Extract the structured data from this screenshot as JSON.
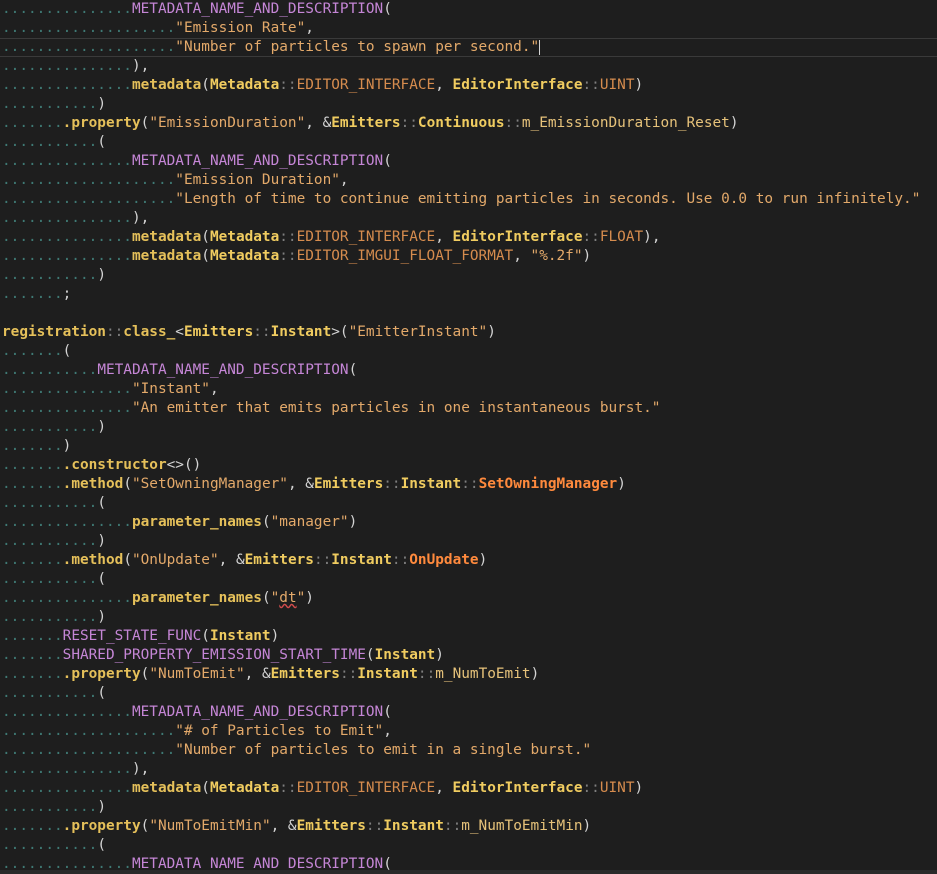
{
  "editor": {
    "lines": [
      [
        {
          "t": "...............",
          "c": "ws"
        },
        {
          "t": "METADATA_NAME_AND_DESCRIPTION",
          "c": "t-macro"
        },
        {
          "t": "(",
          "c": "t-punc"
        }
      ],
      [
        {
          "t": "....................",
          "c": "ws"
        },
        {
          "t": "\"Emission Rate\"",
          "c": "t-str"
        },
        {
          "t": ",",
          "c": "t-punc"
        }
      ],
      [
        {
          "t": "....................",
          "c": "ws"
        },
        {
          "t": "\"Number of particles to spawn per second.\"",
          "c": "t-str"
        },
        {
          "t": "|",
          "c": "cursor"
        }
      ],
      [
        {
          "t": "...............",
          "c": "ws"
        },
        {
          "t": "),",
          "c": "t-punc"
        }
      ],
      [
        {
          "t": "...............",
          "c": "ws"
        },
        {
          "t": "metadata",
          "c": "t-fn"
        },
        {
          "t": "(",
          "c": "t-punc"
        },
        {
          "t": "Metadata",
          "c": "t-type"
        },
        {
          "t": "::",
          "c": "t-op"
        },
        {
          "t": "EDITOR_INTERFACE",
          "c": "t-enum"
        },
        {
          "t": ", ",
          "c": "t-punc"
        },
        {
          "t": "EditorInterface",
          "c": "t-type"
        },
        {
          "t": "::",
          "c": "t-op"
        },
        {
          "t": "UINT",
          "c": "t-enum"
        },
        {
          "t": ")",
          "c": "t-punc"
        }
      ],
      [
        {
          "t": "...........",
          "c": "ws"
        },
        {
          "t": ")",
          "c": "t-punc"
        }
      ],
      [
        {
          "t": ".......",
          "c": "ws"
        },
        {
          "t": ".property",
          "c": "t-fn"
        },
        {
          "t": "(",
          "c": "t-punc"
        },
        {
          "t": "\"EmissionDuration\"",
          "c": "t-str"
        },
        {
          "t": ", &",
          "c": "t-punc"
        },
        {
          "t": "Emitters",
          "c": "t-type"
        },
        {
          "t": "::",
          "c": "t-op"
        },
        {
          "t": "Continuous",
          "c": "t-type"
        },
        {
          "t": "::",
          "c": "t-op"
        },
        {
          "t": "m_EmissionDuration_Reset",
          "c": "t-member"
        },
        {
          "t": ")",
          "c": "t-punc"
        }
      ],
      [
        {
          "t": "...........",
          "c": "ws"
        },
        {
          "t": "(",
          "c": "t-punc"
        }
      ],
      [
        {
          "t": "...............",
          "c": "ws"
        },
        {
          "t": "METADATA_NAME_AND_DESCRIPTION",
          "c": "t-macro"
        },
        {
          "t": "(",
          "c": "t-punc"
        }
      ],
      [
        {
          "t": "....................",
          "c": "ws"
        },
        {
          "t": "\"Emission Duration\"",
          "c": "t-str"
        },
        {
          "t": ",",
          "c": "t-punc"
        }
      ],
      [
        {
          "t": "....................",
          "c": "ws"
        },
        {
          "t": "\"Length of time to continue emitting particles in seconds. Use 0.0 to run infinitely.\"",
          "c": "t-str"
        }
      ],
      [
        {
          "t": "...............",
          "c": "ws"
        },
        {
          "t": "),",
          "c": "t-punc"
        }
      ],
      [
        {
          "t": "...............",
          "c": "ws"
        },
        {
          "t": "metadata",
          "c": "t-fn"
        },
        {
          "t": "(",
          "c": "t-punc"
        },
        {
          "t": "Metadata",
          "c": "t-type"
        },
        {
          "t": "::",
          "c": "t-op"
        },
        {
          "t": "EDITOR_INTERFACE",
          "c": "t-enum"
        },
        {
          "t": ", ",
          "c": "t-punc"
        },
        {
          "t": "EditorInterface",
          "c": "t-type"
        },
        {
          "t": "::",
          "c": "t-op"
        },
        {
          "t": "FLOAT",
          "c": "t-enum"
        },
        {
          "t": "),",
          "c": "t-punc"
        }
      ],
      [
        {
          "t": "...............",
          "c": "ws"
        },
        {
          "t": "metadata",
          "c": "t-fn"
        },
        {
          "t": "(",
          "c": "t-punc"
        },
        {
          "t": "Metadata",
          "c": "t-type"
        },
        {
          "t": "::",
          "c": "t-op"
        },
        {
          "t": "EDITOR_IMGUI_FLOAT_FORMAT",
          "c": "t-enum"
        },
        {
          "t": ", ",
          "c": "t-punc"
        },
        {
          "t": "\"%.2f\"",
          "c": "t-str"
        },
        {
          "t": ")",
          "c": "t-punc"
        }
      ],
      [
        {
          "t": "...........",
          "c": "ws"
        },
        {
          "t": ")",
          "c": "t-punc"
        }
      ],
      [
        {
          "t": ".......",
          "c": "ws"
        },
        {
          "t": ";",
          "c": "t-punc"
        }
      ],
      [
        {
          "t": "",
          "c": "t-plain"
        }
      ],
      [
        {
          "t": "registration",
          "c": "t-fn"
        },
        {
          "t": "::",
          "c": "t-op"
        },
        {
          "t": "class_",
          "c": "t-fn"
        },
        {
          "t": "<",
          "c": "t-punc"
        },
        {
          "t": "Emitters",
          "c": "t-type"
        },
        {
          "t": "::",
          "c": "t-op"
        },
        {
          "t": "Instant",
          "c": "t-type"
        },
        {
          "t": ">(",
          "c": "t-punc"
        },
        {
          "t": "\"EmitterInstant\"",
          "c": "t-str"
        },
        {
          "t": ")",
          "c": "t-punc"
        }
      ],
      [
        {
          "t": ".......",
          "c": "ws"
        },
        {
          "t": "(",
          "c": "t-punc"
        }
      ],
      [
        {
          "t": "...........",
          "c": "ws"
        },
        {
          "t": "METADATA_NAME_AND_DESCRIPTION",
          "c": "t-macro"
        },
        {
          "t": "(",
          "c": "t-punc"
        }
      ],
      [
        {
          "t": "...............",
          "c": "ws"
        },
        {
          "t": "\"Instant\"",
          "c": "t-str"
        },
        {
          "t": ",",
          "c": "t-punc"
        }
      ],
      [
        {
          "t": "...............",
          "c": "ws"
        },
        {
          "t": "\"An emitter that emits particles in one instantaneous burst.\"",
          "c": "t-str"
        }
      ],
      [
        {
          "t": "...........",
          "c": "ws"
        },
        {
          "t": ")",
          "c": "t-punc"
        }
      ],
      [
        {
          "t": ".......",
          "c": "ws"
        },
        {
          "t": ")",
          "c": "t-punc"
        }
      ],
      [
        {
          "t": ".......",
          "c": "ws"
        },
        {
          "t": ".constructor",
          "c": "t-fn"
        },
        {
          "t": "<>()",
          "c": "t-punc"
        }
      ],
      [
        {
          "t": ".......",
          "c": "ws"
        },
        {
          "t": ".method",
          "c": "t-fn"
        },
        {
          "t": "(",
          "c": "t-punc"
        },
        {
          "t": "\"SetOwningManager\"",
          "c": "t-str"
        },
        {
          "t": ", &",
          "c": "t-punc"
        },
        {
          "t": "Emitters",
          "c": "t-type"
        },
        {
          "t": "::",
          "c": "t-op"
        },
        {
          "t": "Instant",
          "c": "t-type"
        },
        {
          "t": "::",
          "c": "t-op"
        },
        {
          "t": "SetOwningManager",
          "c": "t-method"
        },
        {
          "t": ")",
          "c": "t-punc"
        }
      ],
      [
        {
          "t": "...........",
          "c": "ws"
        },
        {
          "t": "(",
          "c": "t-punc"
        }
      ],
      [
        {
          "t": "...............",
          "c": "ws"
        },
        {
          "t": "parameter_names",
          "c": "t-fn"
        },
        {
          "t": "(",
          "c": "t-punc"
        },
        {
          "t": "\"manager\"",
          "c": "t-str"
        },
        {
          "t": ")",
          "c": "t-punc"
        }
      ],
      [
        {
          "t": "...........",
          "c": "ws"
        },
        {
          "t": ")",
          "c": "t-punc"
        }
      ],
      [
        {
          "t": ".......",
          "c": "ws"
        },
        {
          "t": ".method",
          "c": "t-fn"
        },
        {
          "t": "(",
          "c": "t-punc"
        },
        {
          "t": "\"OnUpdate\"",
          "c": "t-str"
        },
        {
          "t": ", &",
          "c": "t-punc"
        },
        {
          "t": "Emitters",
          "c": "t-type"
        },
        {
          "t": "::",
          "c": "t-op"
        },
        {
          "t": "Instant",
          "c": "t-type"
        },
        {
          "t": "::",
          "c": "t-op"
        },
        {
          "t": "OnUpdate",
          "c": "t-method"
        },
        {
          "t": ")",
          "c": "t-punc"
        }
      ],
      [
        {
          "t": "...........",
          "c": "ws"
        },
        {
          "t": "(",
          "c": "t-punc"
        }
      ],
      [
        {
          "t": "...............",
          "c": "ws"
        },
        {
          "t": "parameter_names",
          "c": "t-fn"
        },
        {
          "t": "(",
          "c": "t-punc"
        },
        {
          "t": "\"",
          "c": "t-str"
        },
        {
          "t": "dt",
          "c": "t-str squiggle"
        },
        {
          "t": "\"",
          "c": "t-str"
        },
        {
          "t": ")",
          "c": "t-punc"
        }
      ],
      [
        {
          "t": "...........",
          "c": "ws"
        },
        {
          "t": ")",
          "c": "t-punc"
        }
      ],
      [
        {
          "t": ".......",
          "c": "ws"
        },
        {
          "t": "RESET_STATE_FUNC",
          "c": "t-macro"
        },
        {
          "t": "(",
          "c": "t-punc"
        },
        {
          "t": "Instant",
          "c": "t-type"
        },
        {
          "t": ")",
          "c": "t-punc"
        }
      ],
      [
        {
          "t": ".......",
          "c": "ws"
        },
        {
          "t": "SHARED_PROPERTY_EMISSION_START_TIME",
          "c": "t-macro"
        },
        {
          "t": "(",
          "c": "t-punc"
        },
        {
          "t": "Instant",
          "c": "t-type"
        },
        {
          "t": ")",
          "c": "t-punc"
        }
      ],
      [
        {
          "t": ".......",
          "c": "ws"
        },
        {
          "t": ".property",
          "c": "t-fn"
        },
        {
          "t": "(",
          "c": "t-punc"
        },
        {
          "t": "\"NumToEmit\"",
          "c": "t-str"
        },
        {
          "t": ", &",
          "c": "t-punc"
        },
        {
          "t": "Emitters",
          "c": "t-type"
        },
        {
          "t": "::",
          "c": "t-op"
        },
        {
          "t": "Instant",
          "c": "t-type"
        },
        {
          "t": "::",
          "c": "t-op"
        },
        {
          "t": "m_NumToEmit",
          "c": "t-member"
        },
        {
          "t": ")",
          "c": "t-punc"
        }
      ],
      [
        {
          "t": "...........",
          "c": "ws"
        },
        {
          "t": "(",
          "c": "t-punc"
        }
      ],
      [
        {
          "t": "...............",
          "c": "ws"
        },
        {
          "t": "METADATA_NAME_AND_DESCRIPTION",
          "c": "t-macro"
        },
        {
          "t": "(",
          "c": "t-punc"
        }
      ],
      [
        {
          "t": "....................",
          "c": "ws"
        },
        {
          "t": "\"# of Particles to Emit\"",
          "c": "t-str"
        },
        {
          "t": ",",
          "c": "t-punc"
        }
      ],
      [
        {
          "t": "....................",
          "c": "ws"
        },
        {
          "t": "\"Number of particles to emit in a single burst.\"",
          "c": "t-str"
        }
      ],
      [
        {
          "t": "...............",
          "c": "ws"
        },
        {
          "t": "),",
          "c": "t-punc"
        }
      ],
      [
        {
          "t": "...............",
          "c": "ws"
        },
        {
          "t": "metadata",
          "c": "t-fn"
        },
        {
          "t": "(",
          "c": "t-punc"
        },
        {
          "t": "Metadata",
          "c": "t-type"
        },
        {
          "t": "::",
          "c": "t-op"
        },
        {
          "t": "EDITOR_INTERFACE",
          "c": "t-enum"
        },
        {
          "t": ", ",
          "c": "t-punc"
        },
        {
          "t": "EditorInterface",
          "c": "t-type"
        },
        {
          "t": "::",
          "c": "t-op"
        },
        {
          "t": "UINT",
          "c": "t-enum"
        },
        {
          "t": ")",
          "c": "t-punc"
        }
      ],
      [
        {
          "t": "...........",
          "c": "ws"
        },
        {
          "t": ")",
          "c": "t-punc"
        }
      ],
      [
        {
          "t": ".......",
          "c": "ws"
        },
        {
          "t": ".property",
          "c": "t-fn"
        },
        {
          "t": "(",
          "c": "t-punc"
        },
        {
          "t": "\"NumToEmitMin\"",
          "c": "t-str"
        },
        {
          "t": ", &",
          "c": "t-punc"
        },
        {
          "t": "Emitters",
          "c": "t-type"
        },
        {
          "t": "::",
          "c": "t-op"
        },
        {
          "t": "Instant",
          "c": "t-type"
        },
        {
          "t": "::",
          "c": "t-op"
        },
        {
          "t": "m_NumToEmitMin",
          "c": "t-member"
        },
        {
          "t": ")",
          "c": "t-punc"
        }
      ],
      [
        {
          "t": "...........",
          "c": "ws"
        },
        {
          "t": "(",
          "c": "t-punc"
        }
      ],
      [
        {
          "t": "...............",
          "c": "ws"
        },
        {
          "t": "METADATA_NAME_AND_DESCRIPTION",
          "c": "t-macro"
        },
        {
          "t": "(",
          "c": "t-punc"
        }
      ]
    ],
    "current_line": 2
  }
}
